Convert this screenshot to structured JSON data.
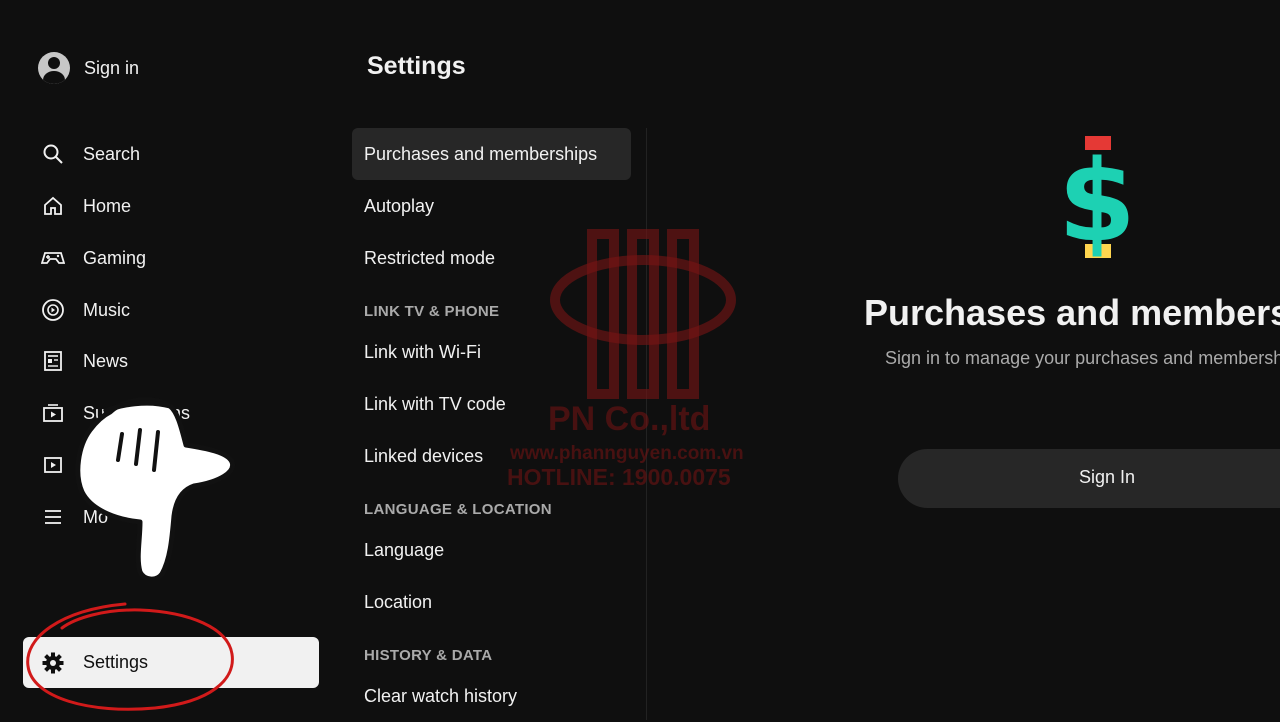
{
  "nav": {
    "sign_in": "Sign in",
    "items": [
      {
        "label": "Search",
        "icon": "search-icon"
      },
      {
        "label": "Home",
        "icon": "home-icon"
      },
      {
        "label": "Gaming",
        "icon": "gamepad-icon"
      },
      {
        "label": "Music",
        "icon": "music-disc-icon"
      },
      {
        "label": "News",
        "icon": "newspaper-icon"
      },
      {
        "label": "Su",
        "label_tail": "ns",
        "icon": "subscriptions-icon"
      },
      {
        "label": "",
        "icon": "library-icon"
      },
      {
        "label": "Mo",
        "icon": "menu-icon"
      }
    ],
    "settings": "Settings"
  },
  "main": {
    "title": "Settings",
    "menu": {
      "purchases": "Purchases and memberships",
      "autoplay": "Autoplay",
      "restricted": "Restricted mode",
      "sec_link": "LINK TV & PHONE",
      "wifi": "Link with Wi-Fi",
      "tvcode": "Link with TV code",
      "linked": "Linked devices",
      "sec_lang": "LANGUAGE & LOCATION",
      "language": "Language",
      "location": "Location",
      "sec_history": "HISTORY & DATA",
      "clear_history": "Clear watch history"
    }
  },
  "pane": {
    "title": "Purchases and membershi",
    "subtitle": "Sign in to manage your purchases and membersh",
    "button": "Sign In",
    "icon_glyph": "$"
  },
  "watermark": {
    "line1": "PN Co.,ltd",
    "line2": "www.phannguyen.com.vn",
    "line3": "HOTLINE: 1900.0075"
  },
  "colors": {
    "background": "#0f0f0f",
    "accent_teal": "#1dd1b3",
    "highlight_red": "#d11a1a"
  }
}
